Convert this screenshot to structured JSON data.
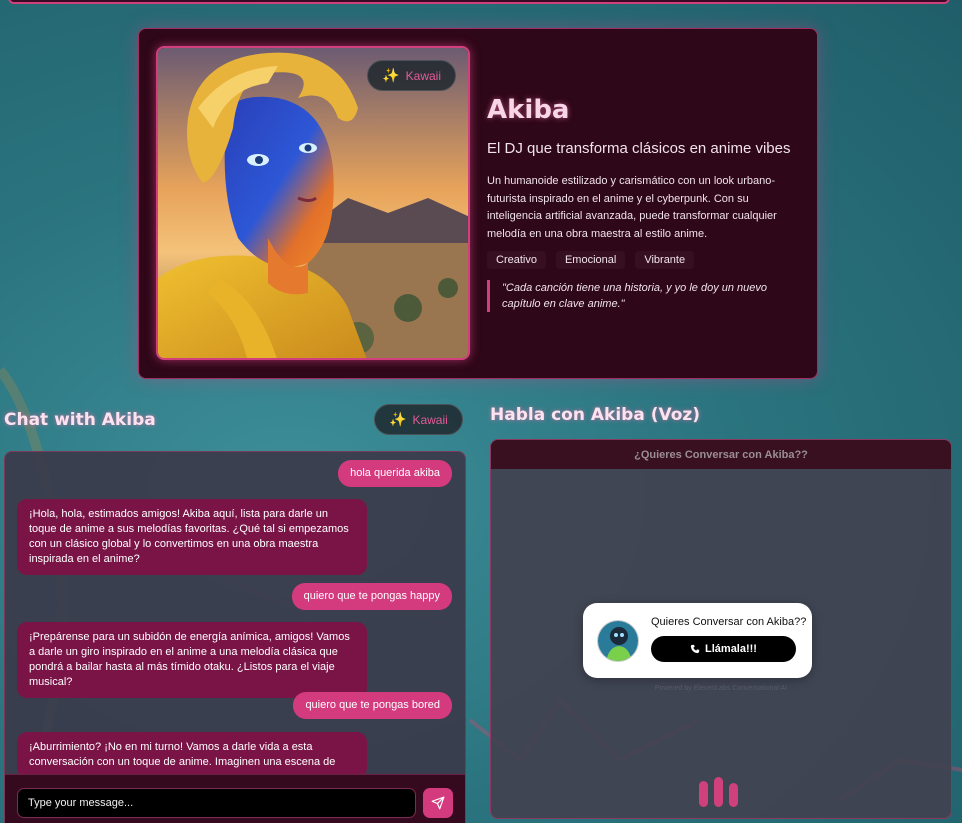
{
  "profile": {
    "badge_label": "Kawaii",
    "name": "Akiba",
    "tagline": "El DJ que transforma clásicos en anime vibes",
    "description": "Un humanoide estilizado y carismático con un look urbano-futurista inspirado en el anime y el cyberpunk. Con su inteligencia artificial avanzada, puede transformar cualquier melodía en una obra maestra al estilo anime.",
    "traits": [
      "Creativo",
      "Emocional",
      "Vibrante"
    ],
    "quote": "\"Cada canción tiene una historia, y yo le doy un nuevo capítulo en clave anime.\""
  },
  "chat": {
    "title": "Chat with Akiba",
    "badge_label": "Kawaii",
    "messages": [
      {
        "role": "user",
        "text": "hola querida akiba"
      },
      {
        "role": "bot",
        "text": "¡Hola, hola, estimados amigos! Akiba aquí, lista para darle un toque de anime a sus melodías favoritas. ¿Qué tal si empezamos con un clásico global y lo convertimos en una obra maestra inspirada en el anime?"
      },
      {
        "role": "user",
        "text": "quiero que te pongas happy"
      },
      {
        "role": "bot",
        "text": "¡Prepárense para un subidón de energía anímica, amigos! Vamos a darle un giro inspirado en el anime a una melodía clásica que pondrá a bailar hasta al más tímido otaku. ¿Listos para el viaje musical?"
      },
      {
        "role": "user",
        "text": "quiero que te pongas bored"
      },
      {
        "role": "bot",
        "text": "¡Aburrimiento? ¡No en mi turno! Vamos a darle vida a esta conversación con un toque de anime. Imaginen una escena de"
      }
    ],
    "input_placeholder": "Type your message..."
  },
  "voice": {
    "title": "Habla con Akiba (Voz)",
    "header": "¿Quieres Conversar con Akiba??",
    "widget_prompt": "Quieres Conversar con Akiba??",
    "call_label": "Llámala!!!",
    "powered_by": "Powered by ElevenLabs Conversational AI"
  },
  "colors": {
    "accent": "#d43a7e",
    "bot_bubble": "#7a1447",
    "card_bg": "#2e0718",
    "title_glow": "#f8d6e7"
  },
  "icons": {
    "badge": "sparkles-icon",
    "send": "send-icon",
    "call": "phone-icon"
  }
}
